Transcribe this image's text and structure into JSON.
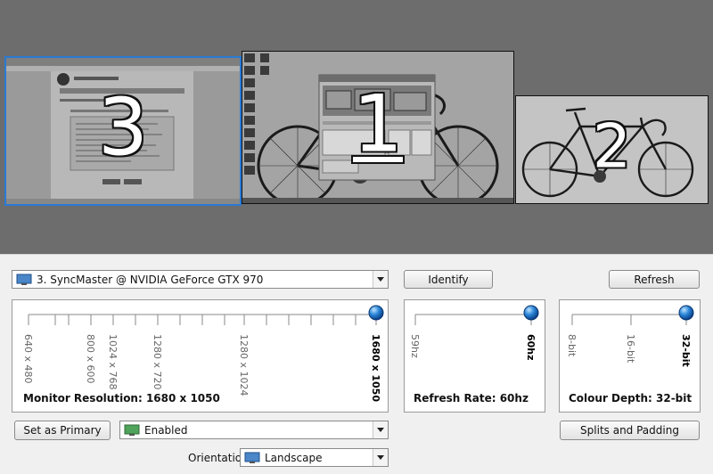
{
  "monitors": [
    {
      "number": "3",
      "selected": true
    },
    {
      "number": "1",
      "selected": false,
      "primary": true
    },
    {
      "number": "2",
      "selected": false
    }
  ],
  "display_select": {
    "value": "3. SyncMaster @ NVIDIA GeForce GTX 970",
    "icon": "monitor-icon"
  },
  "buttons": {
    "identify": "Identify",
    "refresh": "Refresh",
    "set_primary": "Set as Primary",
    "splits": "Splits and Padding"
  },
  "resolution": {
    "ticks": [
      "640 x 480",
      "800 x 600",
      "1024 x 768",
      "1280 x 720",
      "1280 x 1024",
      "1680 x 1050"
    ],
    "selected": "1680 x 1050",
    "caption": "Monitor Resolution: 1680 x 1050"
  },
  "refresh_rate": {
    "ticks": [
      "59hz",
      "60hz"
    ],
    "selected": "60hz",
    "caption": "Refresh Rate: 60hz"
  },
  "colour_depth": {
    "ticks": [
      "8-bit",
      "16-bit",
      "32-bit"
    ],
    "selected": "32-bit",
    "caption": "Colour Depth: 32-bit"
  },
  "enabled_select": {
    "value": "Enabled",
    "icon": "monitor-icon"
  },
  "orientation": {
    "label": "Orientation:",
    "value": "Landscape",
    "icon": "monitor-icon"
  }
}
